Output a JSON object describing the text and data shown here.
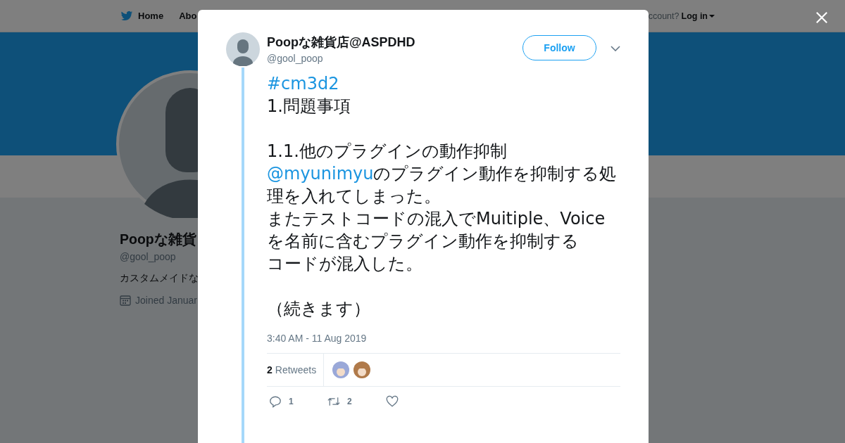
{
  "header": {
    "nav": [
      {
        "label": "Home",
        "selected": false
      },
      {
        "label": "Abo",
        "selected": false
      }
    ],
    "account_prompt": "ccount?",
    "login": "Log in"
  },
  "profile": {
    "name": "Poopな雑貨",
    "handle": "@gool_poop",
    "bio": "カスタムメイドな",
    "joined": "Joined Januar"
  },
  "tweet": {
    "author": "Poopな雑貨店@ASPDHD",
    "handle": "@gool_poop",
    "follow": "Follow",
    "body": [
      {
        "lines": [
          [
            {
              "kind": "hashtag",
              "text": "#cm3d2"
            }
          ],
          [
            {
              "kind": "text",
              "text": "1.問題事項"
            }
          ]
        ]
      },
      {
        "lines": [
          [
            {
              "kind": "text",
              "text": "1.1.他のプラグインの動作抑制"
            }
          ],
          [
            {
              "kind": "mention",
              "text": "@myunimyu"
            },
            {
              "kind": "text",
              "text": "のプラグイン動作を抑制する処理を入れてしまった。"
            }
          ],
          [
            {
              "kind": "text",
              "text": "またテストコードの混入でMuitiple、Voiceを名前に含むプラグイン動作を抑制する"
            }
          ],
          [
            {
              "kind": "text",
              "text": "コードが混入した。"
            }
          ]
        ]
      },
      {
        "lines": [
          [
            {
              "kind": "text",
              "text": "（続きます）"
            }
          ]
        ]
      }
    ],
    "time": "3:40 AM - 11 Aug 2019",
    "retweet_count": "2",
    "retweet_label": "Retweets",
    "retweeters": [
      {
        "color": "#9aa8d8"
      },
      {
        "color": "#b07a4a"
      }
    ],
    "actions": [
      {
        "kind": "reply",
        "count": "1"
      },
      {
        "kind": "retweet",
        "count": "2"
      },
      {
        "kind": "like"
      }
    ]
  }
}
